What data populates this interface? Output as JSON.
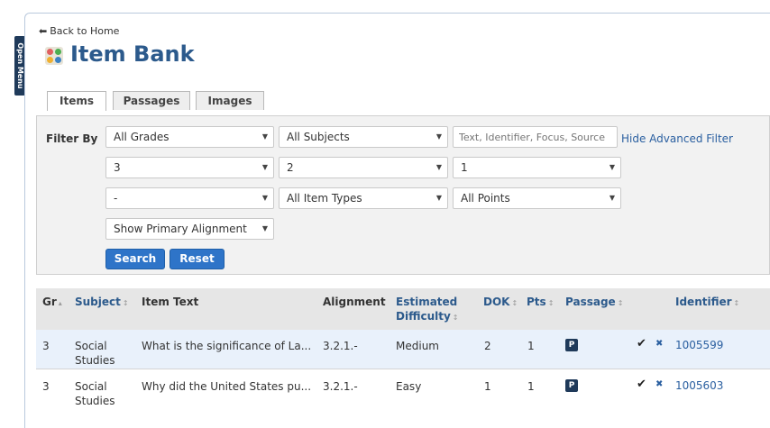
{
  "side_menu": {
    "label": "Open Menu"
  },
  "nav": {
    "back_arrow": "⬅",
    "back_label": "Back to Home"
  },
  "page": {
    "title": "Item Bank",
    "icon": "item-bank-icon"
  },
  "tabs": [
    {
      "label": "Items",
      "active": true
    },
    {
      "label": "Passages",
      "active": false
    },
    {
      "label": "Images",
      "active": false
    }
  ],
  "filter": {
    "label": "Filter By",
    "grade": "All Grades",
    "subject": "All Subjects",
    "search_placeholder": "Text, Identifier, Focus, Source",
    "advanced_link": "Hide Advanced Filter",
    "level1": "3",
    "level2": "2",
    "level3": "1",
    "level4": "-",
    "item_type": "All Item Types",
    "points": "All Points",
    "alignment": "Show Primary Alignment",
    "search_button": "Search",
    "reset_button": "Reset"
  },
  "table": {
    "columns": {
      "grade": "Gr",
      "subject": "Subject",
      "item_text": "Item Text",
      "alignment": "Alignment",
      "difficulty_line1": "Estimated",
      "difficulty_line2": "Difficulty",
      "dok": "DOK",
      "pts": "Pts",
      "passage": "Passage",
      "identifier": "Identifier"
    },
    "sort_asc": "▴",
    "sort_both": "↕",
    "rows": [
      {
        "grade": "3",
        "subject_line1": "Social",
        "subject_line2": "Studies",
        "item_text": "What is the significance of La...",
        "alignment": "3.2.1.-",
        "difficulty": "Medium",
        "dok": "2",
        "pts": "1",
        "passage": "P",
        "check": "✔",
        "flag": "✖",
        "identifier": "1005599"
      },
      {
        "grade": "3",
        "subject_line1": "Social",
        "subject_line2": "Studies",
        "item_text": "Why did the United States pu...",
        "alignment": "3.2.1.-",
        "difficulty": "Easy",
        "dok": "1",
        "pts": "1",
        "passage": "P",
        "check": "✔",
        "flag": "✖",
        "identifier": "1005603"
      }
    ]
  },
  "colors": {
    "brand": "#2c5a8c",
    "button": "#2e74c8",
    "menu": "#1f3a5a",
    "row_highlight": "#e9f1fb"
  }
}
